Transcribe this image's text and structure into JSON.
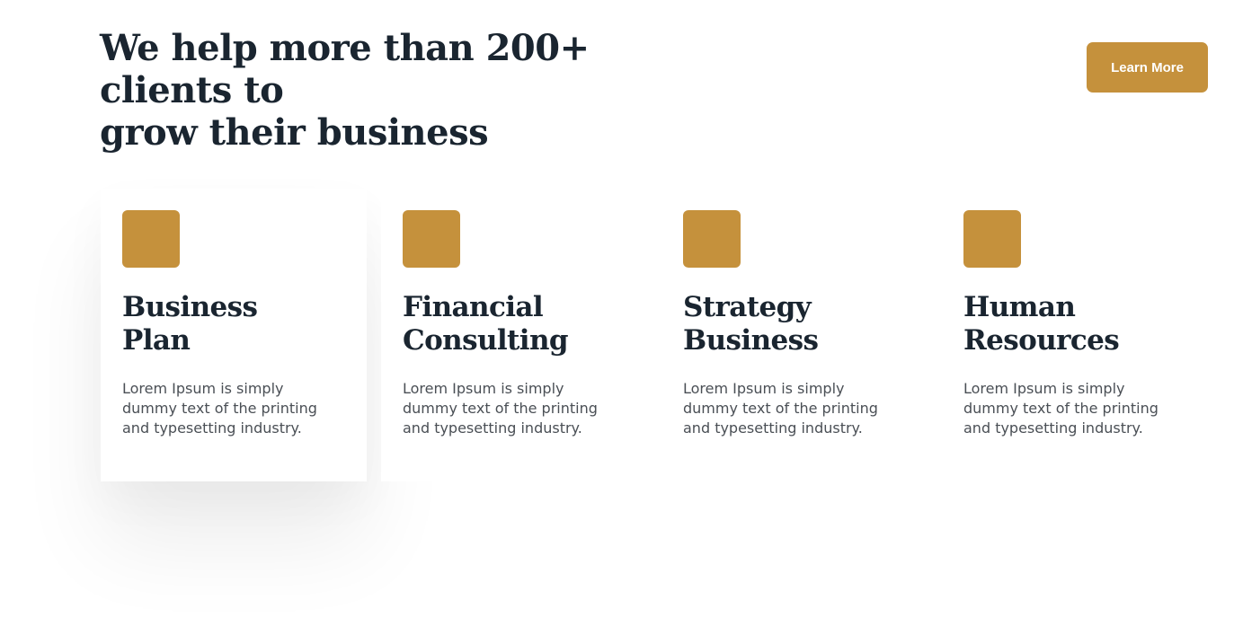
{
  "hero": {
    "headline": "We help more than 200+ clients to\ngrow their business",
    "cta_label": "Learn More"
  },
  "services": [
    {
      "title": "Business\nPlan",
      "description": "Lorem Ipsum is simply dummy text of the printing and typesetting industry.",
      "icon": "service-icon-placeholder",
      "highlighted": true
    },
    {
      "title": "Financial\nConsulting",
      "description": "Lorem Ipsum is simply dummy text of the printing and typesetting industry.",
      "icon": "service-icon-placeholder",
      "highlighted": false
    },
    {
      "title": "Strategy\nBusiness",
      "description": "Lorem Ipsum is simply dummy text of the printing and typesetting industry.",
      "icon": "service-icon-placeholder",
      "highlighted": false
    },
    {
      "title": "Human\nResources",
      "description": "Lorem Ipsum is simply dummy text of the printing and typesetting industry.",
      "icon": "service-icon-placeholder",
      "highlighted": false
    }
  ],
  "colors": {
    "accent": "#c5913c",
    "heading": "#1a2530",
    "body_text": "#4a4f55",
    "background": "#ffffff"
  }
}
